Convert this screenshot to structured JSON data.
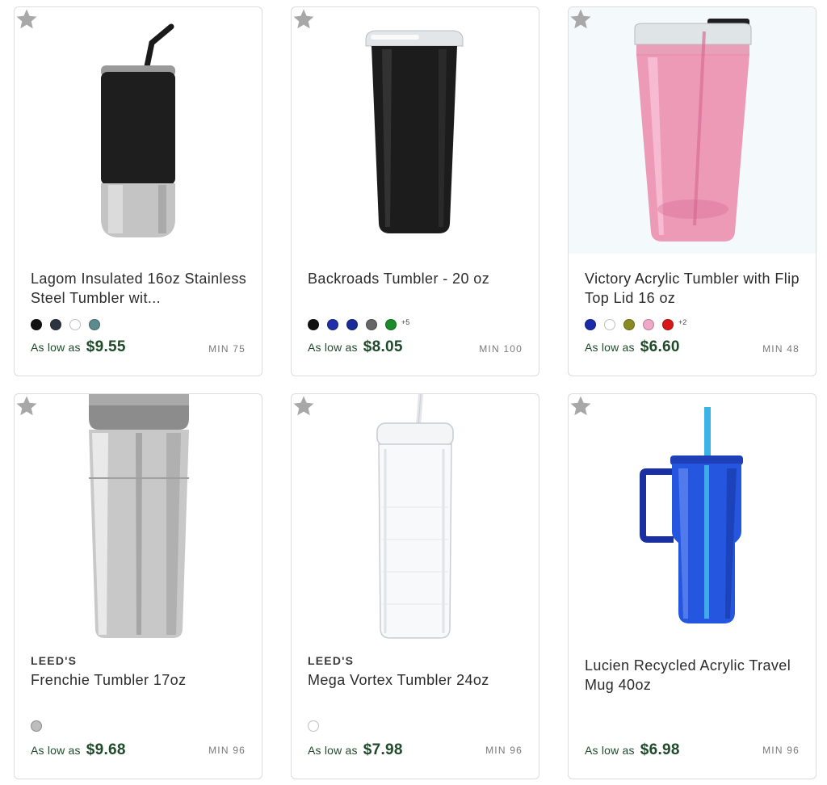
{
  "products": [
    {
      "title": "Lagom Insulated 16oz Stainless Steel Tumbler wit...",
      "brand": "",
      "swatches": [
        "#111111",
        "#2d3440",
        "#ffffff",
        "#5b8a8f"
      ],
      "more": "",
      "as_low_as": "As low as",
      "price": "$9.55",
      "min": "MIN 75",
      "image": "black-insulated-tumbler-with-straw"
    },
    {
      "title": "Backroads Tumbler - 20 oz",
      "brand": "",
      "swatches": [
        "#111111",
        "#1f2fa8",
        "#1b2b9a",
        "#666666",
        "#1a8a2a"
      ],
      "more": "+5",
      "as_low_as": "As low as",
      "price": "$8.05",
      "min": "MIN 100",
      "image": "black-tumbler-with-clear-lid"
    },
    {
      "title": "Victory Acrylic Tumbler with Flip Top Lid 16 oz",
      "brand": "",
      "swatches": [
        "#1a2aa8",
        "#ffffff",
        "#8a8a22",
        "#f0a8c8",
        "#d81818"
      ],
      "more": "+2",
      "as_low_as": "As low as",
      "price": "$6.60",
      "min": "MIN 48",
      "image": "pink-acrylic-tumbler"
    },
    {
      "title": "Frenchie Tumbler 17oz",
      "brand": "LEED'S",
      "swatches": [
        "#bdbdbd"
      ],
      "more": "",
      "as_low_as": "As low as",
      "price": "$9.68",
      "min": "MIN 96",
      "image": "stainless-steel-tumbler"
    },
    {
      "title": "Mega Vortex Tumbler 24oz",
      "brand": "LEED'S",
      "swatches": [
        "#ffffff"
      ],
      "more": "",
      "as_low_as": "As low as",
      "price": "$7.98",
      "min": "MIN 96",
      "image": "clear-tumbler-with-straw"
    },
    {
      "title": "Lucien Recycled Acrylic Travel Mug 40oz",
      "brand": "",
      "swatches": [],
      "more": "",
      "as_low_as": "As low as",
      "price": "$6.98",
      "min": "MIN 96",
      "image": "blue-travel-mug-with-handle"
    }
  ],
  "favorite_icon": "star-icon",
  "colors": {
    "price_green": "#1f4a2a",
    "card_border": "#dcdcdc",
    "star_gray": "#a8a8a8"
  }
}
